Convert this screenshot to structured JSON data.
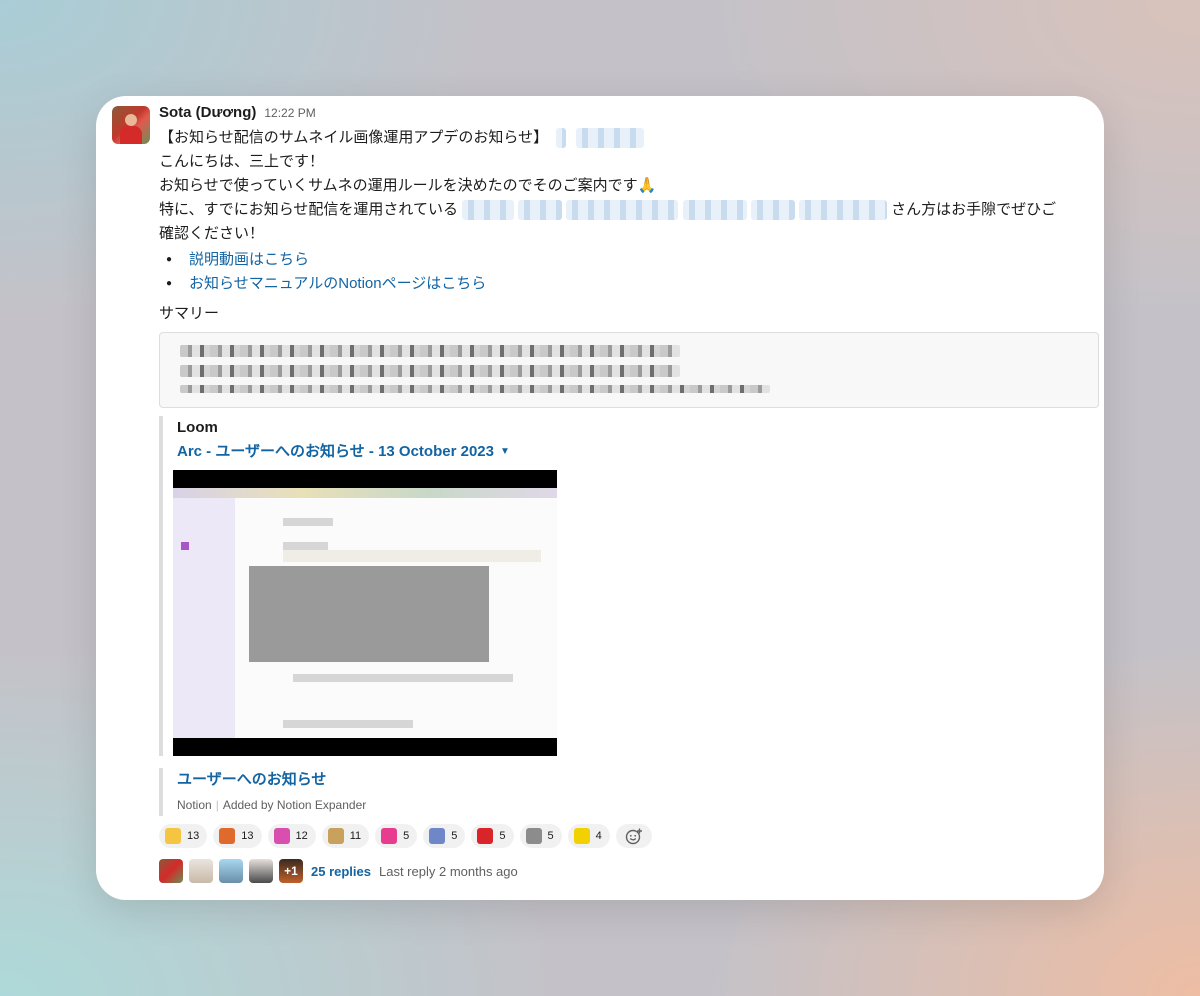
{
  "message": {
    "author": "Sota (Dương)",
    "time": "12:22 PM",
    "title_line": "【お知らせ配信のサムネイル画像運用アプデのお知らせ】",
    "line2": "こんにちは、三上です！",
    "line3": "お知らせで使っていくサムネの運用ルールを決めたのでそのご案内です",
    "line3_emoji": "🙏",
    "line4_pre": "特に、すでにお知らせ配信を運用されている",
    "line4_post": "さん方はお手隙でぜひご",
    "line5": "確認ください！",
    "bullets": [
      "説明動画はこちら",
      "お知らせマニュアルのNotionページはこちら"
    ],
    "summary_title": "サマリー"
  },
  "loom": {
    "service": "Loom",
    "title": "Arc - ユーザーへのお知らせ - 13 October 2023",
    "caret": "▼"
  },
  "notion": {
    "title": "ユーザーへのお知らせ",
    "source": "Notion",
    "added_by": "Added by Notion Expander"
  },
  "reactions": [
    {
      "icon": "clap-emoji",
      "count": "13",
      "color": "#f5c542"
    },
    {
      "icon": "party-parrot-emoji",
      "count": "13",
      "color": "#e06a2c"
    },
    {
      "icon": "confetti-emoji",
      "count": "12",
      "color": "#d94fb0"
    },
    {
      "icon": "portrait-emoji",
      "count": "11",
      "color": "#c8a25c"
    },
    {
      "icon": "text-emoji-pink",
      "count": "5",
      "color": "#e83c8e"
    },
    {
      "icon": "text-emoji-blue",
      "count": "5",
      "color": "#6f86c9"
    },
    {
      "icon": "big-emoji",
      "count": "5",
      "color": "#d9252a"
    },
    {
      "icon": "hands-emoji",
      "count": "5",
      "color": "#8c8c8c"
    },
    {
      "icon": "sticker-emoji",
      "count": "4",
      "color": "#f2d100"
    }
  ],
  "thread": {
    "extra_count": "+1",
    "replies": "25 replies",
    "last_reply": "Last reply 2 months ago"
  }
}
